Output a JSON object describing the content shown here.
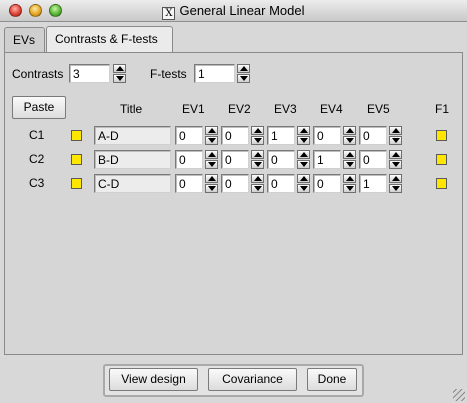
{
  "window": {
    "title": "General Linear Model"
  },
  "tabs": [
    {
      "label": "EVs"
    },
    {
      "label": "Contrasts & F-tests"
    }
  ],
  "counts": {
    "contrasts_label": "Contrasts",
    "contrasts_value": "3",
    "ftests_label": "F-tests",
    "ftests_value": "1"
  },
  "buttons": {
    "paste": "Paste",
    "view_design": "View design",
    "covariance": "Covariance",
    "done": "Done"
  },
  "headers": {
    "title": "Title",
    "ev": [
      "EV1",
      "EV2",
      "EV3",
      "EV4",
      "EV5"
    ],
    "f": "F1"
  },
  "checkbox_color": "#ffe600",
  "contrasts": [
    {
      "label": "C1",
      "title": "A-D",
      "evs": [
        "0",
        "0",
        "1",
        "0",
        "0"
      ]
    },
    {
      "label": "C2",
      "title": "B-D",
      "evs": [
        "0",
        "0",
        "0",
        "1",
        "0"
      ]
    },
    {
      "label": "C3",
      "title": "C-D",
      "evs": [
        "0",
        "0",
        "0",
        "0",
        "1"
      ]
    }
  ]
}
